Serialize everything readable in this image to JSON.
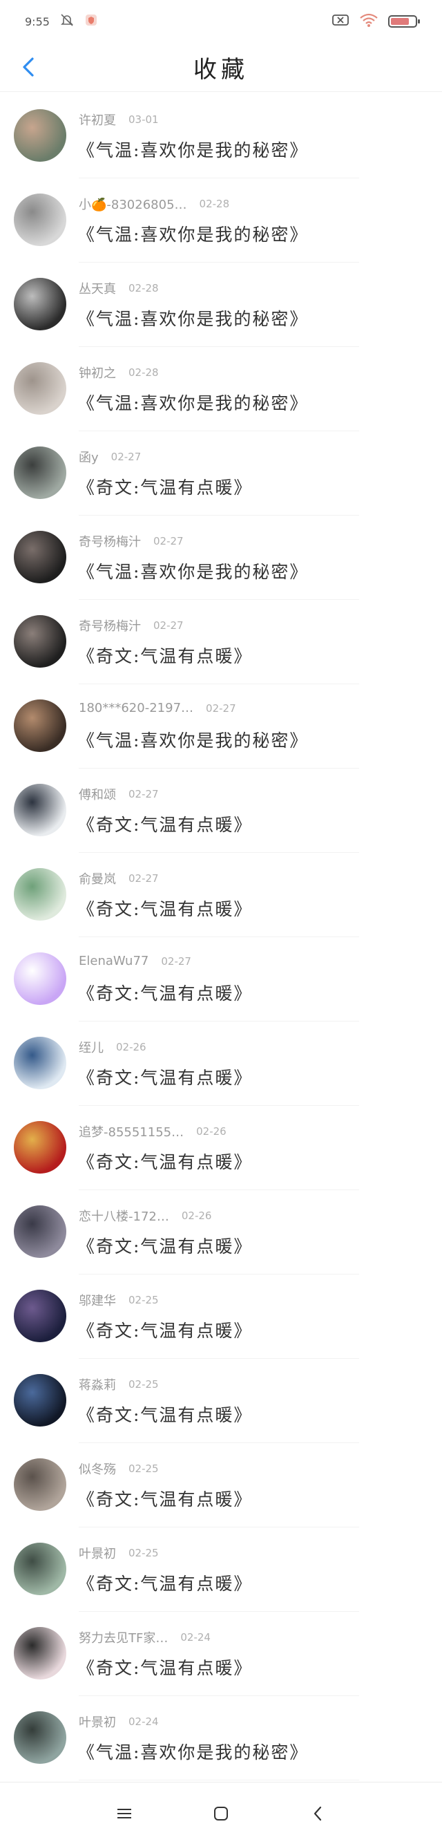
{
  "status_bar": {
    "time": "9:55",
    "icons": [
      "bell-muted-icon",
      "app-shield-icon",
      "sim-icon",
      "wifi-icon",
      "battery-icon"
    ],
    "battery_level": 0.75
  },
  "header": {
    "title": "收藏",
    "back_icon": "chevron-left-icon",
    "accent": "#2f8df0"
  },
  "items": [
    {
      "name": "许初夏",
      "date": "03-01",
      "content": "《气温:喜欢你是我的秘密》"
    },
    {
      "name": "小🍊-83026805…",
      "date": "02-28",
      "content": "《气温:喜欢你是我的秘密》"
    },
    {
      "name": "丛天真",
      "date": "02-28",
      "content": "《气温:喜欢你是我的秘密》"
    },
    {
      "name": "钟初之",
      "date": "02-28",
      "content": "《气温:喜欢你是我的秘密》"
    },
    {
      "name": "函y",
      "date": "02-27",
      "content": "《奇文:气温有点暖》"
    },
    {
      "name": "奇号杨梅汁",
      "date": "02-27",
      "content": "《气温:喜欢你是我的秘密》"
    },
    {
      "name": "奇号杨梅汁",
      "date": "02-27",
      "content": "《奇文:气温有点暖》"
    },
    {
      "name": "180***620-2197…",
      "date": "02-27",
      "content": "《气温:喜欢你是我的秘密》"
    },
    {
      "name": "傅和颂",
      "date": "02-27",
      "content": "《奇文:气温有点暖》"
    },
    {
      "name": "俞曼岚",
      "date": "02-27",
      "content": "《奇文:气温有点暖》"
    },
    {
      "name": "ElenaWu77",
      "date": "02-27",
      "content": "《奇文:气温有点暖》"
    },
    {
      "name": "绖儿",
      "date": "02-26",
      "content": "《奇文:气温有点暖》"
    },
    {
      "name": "追梦-85551155…",
      "date": "02-26",
      "content": "《奇文:气温有点暖》"
    },
    {
      "name": "恋十八楼-172…",
      "date": "02-26",
      "content": "《奇文:气温有点暖》"
    },
    {
      "name": "邬建华",
      "date": "02-25",
      "content": "《奇文:气温有点暖》"
    },
    {
      "name": "蒋淼莉",
      "date": "02-25",
      "content": "《奇文:气温有点暖》"
    },
    {
      "name": "似冬殇",
      "date": "02-25",
      "content": "《奇文:气温有点暖》"
    },
    {
      "name": "叶景初",
      "date": "02-25",
      "content": "《奇文:气温有点暖》"
    },
    {
      "name": "努力去见TF家…",
      "date": "02-24",
      "content": "《奇文:气温有点暖》"
    },
    {
      "name": "叶景初",
      "date": "02-24",
      "content": "《气温:喜欢你是我的秘密》"
    }
  ],
  "nav_bar": {
    "icons": [
      "menu-icon",
      "home-square-icon",
      "back-triangle-icon"
    ]
  }
}
